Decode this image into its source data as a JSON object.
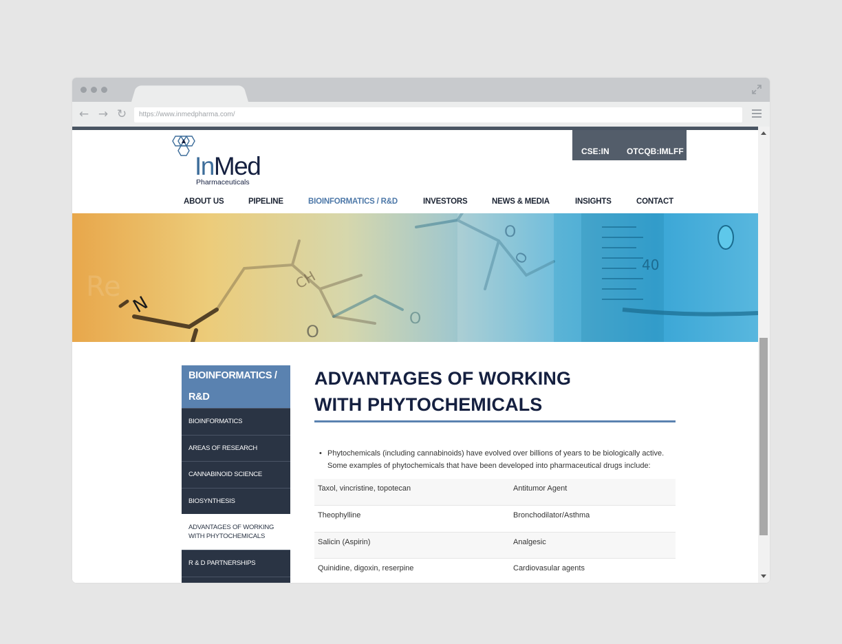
{
  "browser": {
    "url": "https://www.inmedpharma.com/"
  },
  "header": {
    "logo_main_in": "In",
    "logo_main_med": "Med",
    "logo_sub": "Pharmaceuticals",
    "tickers": [
      "CSE:IN",
      "OTCQB:IMLFF"
    ]
  },
  "nav": {
    "items": [
      "ABOUT US",
      "PIPELINE",
      "BIOINFORMATICS / R&D",
      "INVESTORS",
      "NEWS & MEDIA",
      "INSIGHTS",
      "CONTACT"
    ],
    "active": "BIOINFORMATICS / R&D"
  },
  "hero": {
    "mol_labels": [
      "N",
      "CH",
      "O",
      "O",
      "O",
      "O",
      "40",
      "Re"
    ]
  },
  "sidebar": {
    "title": "BIOINFORMATICS / R&D",
    "items": [
      {
        "label": "BIOINFORMATICS",
        "current": false
      },
      {
        "label": "AREAS OF RESEARCH",
        "current": false
      },
      {
        "label": "CANNABINOID SCIENCE",
        "current": false
      },
      {
        "label": "BIOSYNTHESIS",
        "current": false
      },
      {
        "label": "ADVANTAGES OF WORKING WITH PHYTOCHEMICALS",
        "current": true
      },
      {
        "label": "R & D PARTNERSHIPS",
        "current": false
      }
    ]
  },
  "content": {
    "heading_line1": "ADVANTAGES OF WORKING",
    "heading_line2": "WITH PHYTOCHEMICALS",
    "intro": "Phytochemicals (including cannabinoids) have evolved over billions of years to be biologically active. Some examples of phytochemicals that have been developed into pharmaceutical drugs include:",
    "table": [
      [
        "Taxol, vincristine, topotecan",
        "Antitumor Agent"
      ],
      [
        "Theophylline",
        "Bronchodilator/Asthma"
      ],
      [
        "Salicin (Aspirin)",
        "Analgesic"
      ],
      [
        "Quinidine, digoxin, reserpine",
        "Cardiovasular agents"
      ]
    ]
  },
  "colors": {
    "navy": "#152040",
    "accent": "#5a82b0",
    "sidebar_dark": "#2a3444",
    "ticker_bg": "#535d6a"
  }
}
